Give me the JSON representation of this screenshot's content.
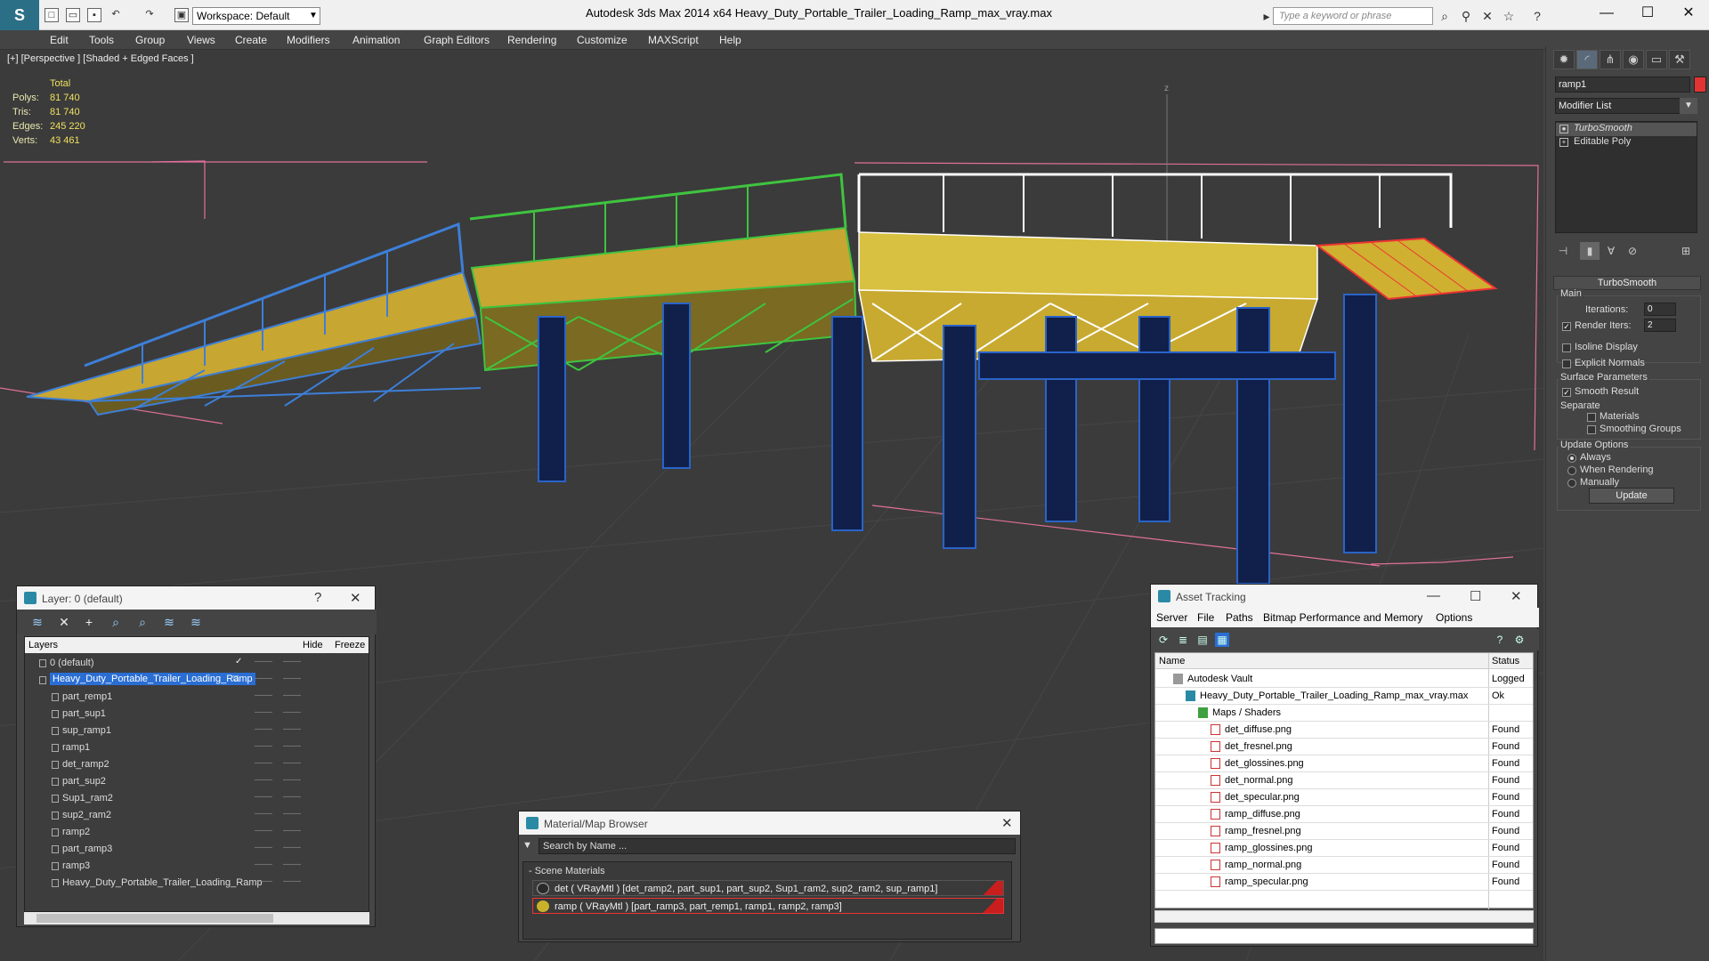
{
  "app": {
    "title": "Autodesk 3ds Max  2014 x64",
    "filename": "Heavy_Duty_Portable_Trailer_Loading_Ramp_max_vray.max",
    "workspace": "Workspace: Default",
    "search_placeholder": "Type a keyword or phrase"
  },
  "menu": [
    "Edit",
    "Tools",
    "Group",
    "Views",
    "Create",
    "Modifiers",
    "Animation",
    "Graph Editors",
    "Rendering",
    "Customize",
    "MAXScript",
    "Help"
  ],
  "viewport": {
    "label": "[+] [Perspective ] [Shaded + Edged Faces ]",
    "stats": {
      "header": "Total",
      "rows": [
        {
          "label": "Polys:",
          "value": "81 740"
        },
        {
          "label": "Tris:",
          "value": "81 740"
        },
        {
          "label": "Edges:",
          "value": "245 220"
        },
        {
          "label": "Verts:",
          "value": "43 461"
        }
      ]
    },
    "axis_label": "z"
  },
  "command_panel": {
    "object_name": "ramp1",
    "modifier_list": "Modifier List",
    "stack": [
      "TurboSmooth",
      "Editable Poly"
    ],
    "rollout_title": "TurboSmooth",
    "main_group": "Main",
    "iterations_label": "Iterations:",
    "iterations_value": "0",
    "render_iters_label": "Render Iters:",
    "render_iters_value": "2",
    "isoline_label": "Isoline Display",
    "explicit_normals_label": "Explicit Normals",
    "surface_group": "Surface Parameters",
    "smooth_result_label": "Smooth Result",
    "separate_label": "Separate",
    "materials_label": "Materials",
    "smoothing_groups_label": "Smoothing Groups",
    "update_group": "Update Options",
    "always_label": "Always",
    "when_rendering_label": "When Rendering",
    "manually_label": "Manually",
    "update_button": "Update",
    "object_color": "#e33333"
  },
  "layer_panel": {
    "title": "Layer: 0 (default)",
    "help": "?",
    "columns": {
      "layers": "Layers",
      "hide": "Hide",
      "freeze": "Freeze"
    },
    "rows": [
      {
        "name": "0 (default)",
        "level": 0
      },
      {
        "name": "Heavy_Duty_Portable_Trailer_Loading_Ramp",
        "level": 0
      },
      {
        "name": "part_remp1",
        "level": 1
      },
      {
        "name": "part_sup1",
        "level": 1
      },
      {
        "name": "sup_ramp1",
        "level": 1
      },
      {
        "name": "ramp1",
        "level": 1
      },
      {
        "name": "det_ramp2",
        "level": 1
      },
      {
        "name": "part_sup2",
        "level": 1
      },
      {
        "name": "Sup1_ram2",
        "level": 1
      },
      {
        "name": "sup2_ram2",
        "level": 1
      },
      {
        "name": "ramp2",
        "level": 1
      },
      {
        "name": "part_ramp3",
        "level": 1
      },
      {
        "name": "ramp3",
        "level": 1
      },
      {
        "name": "Heavy_Duty_Portable_Trailer_Loading_Ramp",
        "level": 1
      }
    ]
  },
  "material_browser": {
    "title": "Material/Map Browser",
    "search_placeholder": "Search by Name ...",
    "section": "- Scene Materials",
    "materials": [
      {
        "label": "det  ( VRayMtl ) [det_ramp2, part_sup1, part_sup2, Sup1_ram2, sup2_ram2, sup_ramp1]",
        "color": "#2a2a2a"
      },
      {
        "label": "ramp  ( VRayMtl ) [part_ramp3, part_remp1, ramp1, ramp2, ramp3]",
        "color": "#c9b22a"
      }
    ]
  },
  "asset_tracking": {
    "title": "Asset Tracking",
    "menu": [
      "Server",
      "File",
      "Paths",
      "Bitmap Performance and Memory",
      "Options"
    ],
    "columns": {
      "name": "Name",
      "status": "Status"
    },
    "rows": [
      {
        "name": "Autodesk Vault",
        "status": "Logged",
        "level": 1,
        "icon": "vault-icon"
      },
      {
        "name": "Heavy_Duty_Portable_Trailer_Loading_Ramp_max_vray.max",
        "status": "Ok",
        "level": 2,
        "icon": "max-file-icon"
      },
      {
        "name": "Maps / Shaders",
        "status": "",
        "level": 3,
        "icon": "maps-icon"
      },
      {
        "name": "det_diffuse.png",
        "status": "Found",
        "level": 4,
        "icon": "png-icon"
      },
      {
        "name": "det_fresnel.png",
        "status": "Found",
        "level": 4,
        "icon": "png-icon"
      },
      {
        "name": "det_glossines.png",
        "status": "Found",
        "level": 4,
        "icon": "png-icon"
      },
      {
        "name": "det_normal.png",
        "status": "Found",
        "level": 4,
        "icon": "png-icon"
      },
      {
        "name": "det_specular.png",
        "status": "Found",
        "level": 4,
        "icon": "png-icon"
      },
      {
        "name": "ramp_diffuse.png",
        "status": "Found",
        "level": 4,
        "icon": "png-icon"
      },
      {
        "name": "ramp_fresnel.png",
        "status": "Found",
        "level": 4,
        "icon": "png-icon"
      },
      {
        "name": "ramp_glossines.png",
        "status": "Found",
        "level": 4,
        "icon": "png-icon"
      },
      {
        "name": "ramp_normal.png",
        "status": "Found",
        "level": 4,
        "icon": "png-icon"
      },
      {
        "name": "ramp_specular.png",
        "status": "Found",
        "level": 4,
        "icon": "png-icon"
      }
    ]
  }
}
